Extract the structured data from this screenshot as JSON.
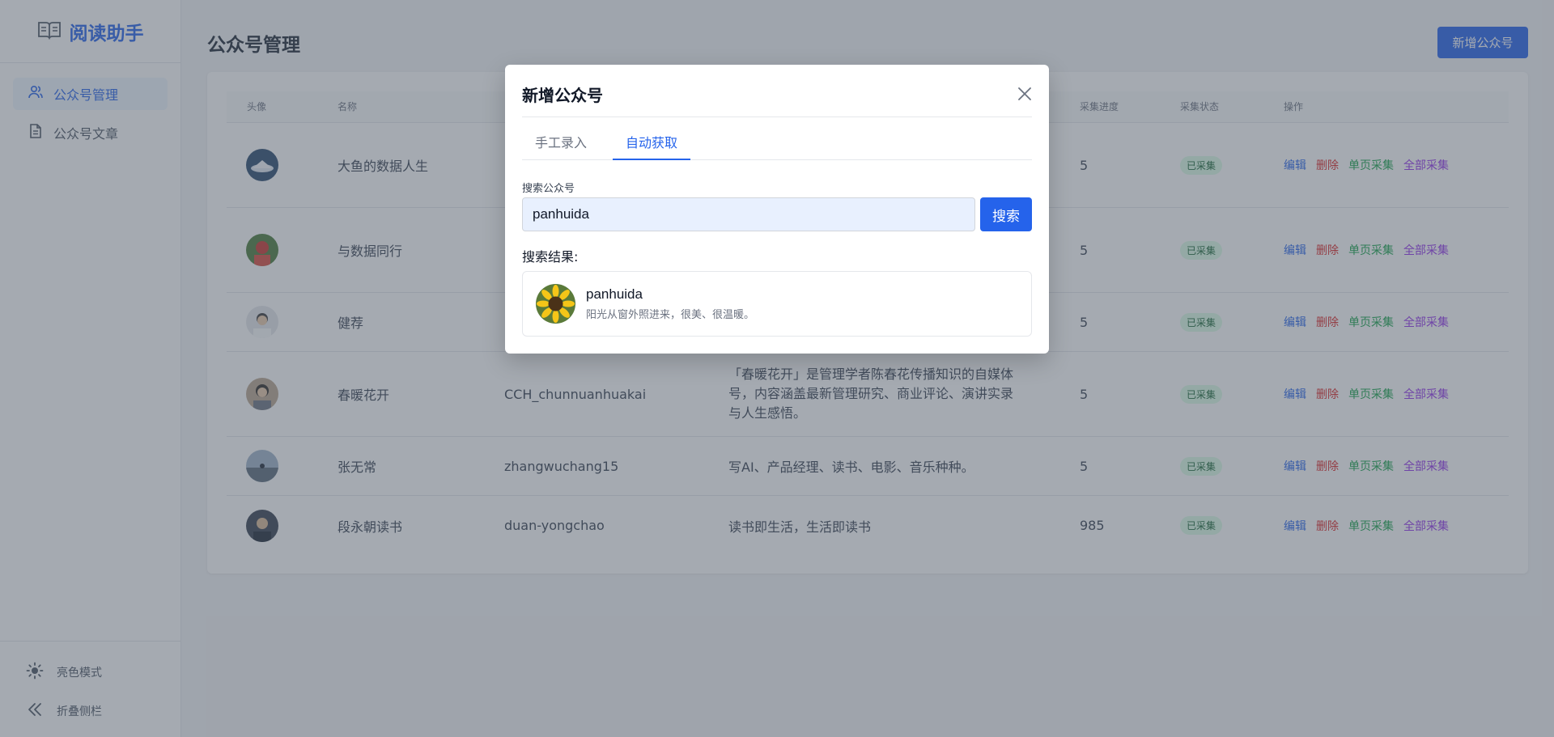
{
  "app": {
    "logo_text": "阅读助手",
    "nav": [
      {
        "label": "公众号管理",
        "active": true
      },
      {
        "label": "公众号文章",
        "active": false
      }
    ],
    "bottom": {
      "theme_label": "亮色模式",
      "collapse_label": "折叠侧栏"
    }
  },
  "page": {
    "title": "公众号管理",
    "add_button": "新增公众号",
    "table": {
      "headers": {
        "avatar": "头像",
        "name": "名称",
        "progress": "采集进度",
        "status": "采集状态",
        "actions": "操作"
      },
      "rows": [
        {
          "name": "大鱼的数据人生",
          "account": "",
          "desc": "",
          "progress": "5",
          "status": "已采集"
        },
        {
          "name": "与数据同行",
          "account": "",
          "desc": "",
          "progress": "5",
          "status": "已采集"
        },
        {
          "name": "健荐",
          "account": "",
          "desc": "",
          "progress": "5",
          "status": "已采集"
        },
        {
          "name": "春暖花开",
          "account": "CCH_chunnuanhuakai",
          "desc": "「春暖花开」是管理学者陈春花传播知识的自媒体号，内容涵盖最新管理研究、商业评论、演讲实录与人生感悟。",
          "progress": "5",
          "status": "已采集"
        },
        {
          "name": "张无常",
          "account": "zhangwuchang15",
          "desc": "写AI、产品经理、读书、电影、音乐种种。",
          "progress": "5",
          "status": "已采集"
        },
        {
          "name": "段永朝读书",
          "account": "duan-yongchao",
          "desc": "读书即生活，生活即读书",
          "progress": "985",
          "status": "已采集"
        }
      ],
      "actions": {
        "edit": "编辑",
        "delete": "删除",
        "single": "单页采集",
        "all": "全部采集"
      }
    }
  },
  "modal": {
    "title": "新增公众号",
    "tabs": [
      {
        "label": "手工录入",
        "active": false
      },
      {
        "label": "自动获取",
        "active": true
      }
    ],
    "search_label": "搜索公众号",
    "search_value": "panhuida",
    "search_button": "搜索",
    "results_label": "搜索结果:",
    "result": {
      "name": "panhuida",
      "desc": "阳光从窗外照进来，很美、很温暖。"
    }
  },
  "colors": {
    "accent": "#2563eb",
    "delete": "#dc2626",
    "single": "#16a34a",
    "all": "#9333ea",
    "badge_bg": "#dcfce7"
  }
}
